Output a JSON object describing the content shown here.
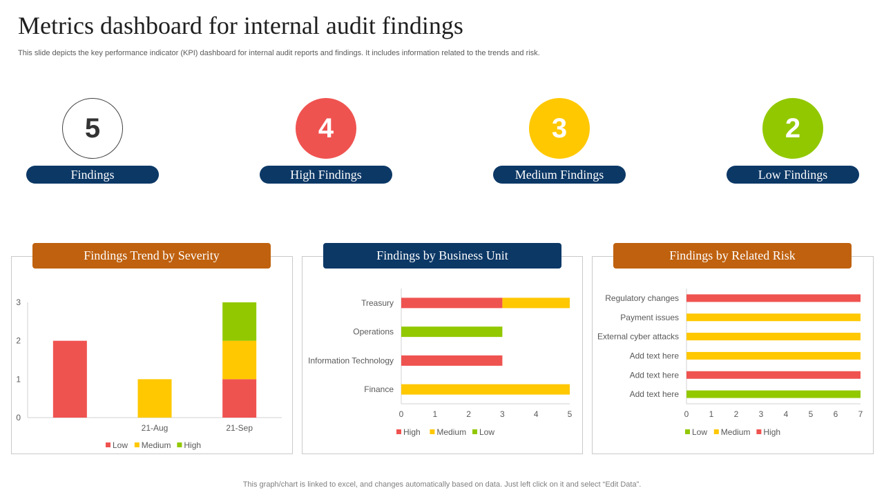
{
  "title": "Metrics dashboard for internal audit findings",
  "subtitle": "This slide depicts the key performance indicator (KPI) dashboard for internal audit reports and findings. It includes information related to the trends and risk.",
  "kpis": [
    {
      "value": "5",
      "label": "Findings",
      "color": "#ffffff"
    },
    {
      "value": "4",
      "label": "High Findings",
      "color": "#ef5350"
    },
    {
      "value": "3",
      "label": "Medium Findings",
      "color": "#ffc800"
    },
    {
      "value": "2",
      "label": "Low Findings",
      "color": "#92c800"
    }
  ],
  "panels": [
    {
      "heading": "Findings Trend by Severity"
    },
    {
      "heading": "Findings by Business Unit"
    },
    {
      "heading": "Findings by Related Risk"
    }
  ],
  "colors": {
    "high": "#ef5350",
    "medium": "#ffc800",
    "low": "#92c800",
    "navy": "#0c3866",
    "orange": "#bf610f"
  },
  "chart_data": [
    {
      "type": "bar",
      "stacked": true,
      "title": "Findings Trend by Severity",
      "categories": [
        "",
        "21-Aug",
        "21-Sep"
      ],
      "series": [
        {
          "name": "Low",
          "color": "#ef5350",
          "values": [
            2,
            0,
            1
          ]
        },
        {
          "name": "Medium",
          "color": "#ffc800",
          "values": [
            0,
            1,
            1
          ]
        },
        {
          "name": "High",
          "color": "#92c800",
          "values": [
            0,
            0,
            1
          ]
        }
      ],
      "ylim": [
        0,
        3
      ],
      "yticks": [
        0,
        1,
        2,
        3
      ],
      "grid": false,
      "legend": "bottom"
    },
    {
      "type": "bar",
      "orientation": "horizontal",
      "stacked": true,
      "title": "Findings by Business Unit",
      "categories": [
        "Treasury",
        "Operations",
        "Information Technology",
        "Finance"
      ],
      "series": [
        {
          "name": "High",
          "color": "#ef5350",
          "values": [
            3,
            0,
            3,
            0
          ]
        },
        {
          "name": "Medium",
          "color": "#ffc800",
          "values": [
            2,
            0,
            0,
            5
          ]
        },
        {
          "name": "Low",
          "color": "#92c800",
          "values": [
            0,
            3,
            0,
            0
          ]
        }
      ],
      "xlim": [
        0,
        5
      ],
      "xticks": [
        0,
        1,
        2,
        3,
        4,
        5
      ],
      "grid": false,
      "legend": "bottom"
    },
    {
      "type": "bar",
      "orientation": "horizontal",
      "stacked": true,
      "title": "Findings by Related Risk",
      "categories": [
        "Regulatory changes",
        "Payment issues",
        "External cyber attacks",
        "Add text here",
        "Add text here",
        "Add text here"
      ],
      "series": [
        {
          "name": "Low",
          "color": "#92c800",
          "values": [
            0,
            0,
            0,
            0,
            0,
            7
          ]
        },
        {
          "name": "Medium",
          "color": "#ffc800",
          "values": [
            0,
            7,
            7,
            7,
            0,
            0
          ]
        },
        {
          "name": "High",
          "color": "#ef5350",
          "values": [
            7,
            0,
            0,
            0,
            7,
            0
          ]
        }
      ],
      "xlim": [
        0,
        7
      ],
      "xticks": [
        0,
        1,
        2,
        3,
        4,
        5,
        6,
        7
      ],
      "grid": false,
      "legend": "bottom"
    }
  ],
  "footer": "This graph/chart is linked to excel,  and changes automatically based on data. Just left click on it and select “Edit Data”."
}
